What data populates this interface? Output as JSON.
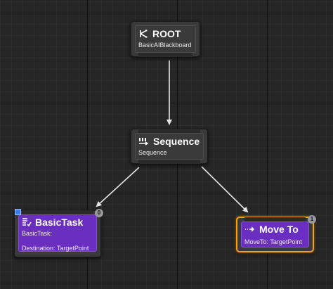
{
  "nodes": {
    "root": {
      "title": "ROOT",
      "subtitle": "BasicAIBlackboard",
      "icon": "root-branch-icon"
    },
    "sequence": {
      "title": "Sequence",
      "subtitle": "Sequence",
      "icon": "sequence-icon"
    },
    "basic_task": {
      "title": "BasicTask",
      "line1": "BasicTask:",
      "line2": "Destination: TargetPoint",
      "order": "0",
      "icon": "task-list-icon"
    },
    "move_to": {
      "title": "Move To",
      "subtitle": "MoveTo: TargetPoint",
      "order": "1",
      "icon": "move-arrow-icon"
    }
  },
  "colors": {
    "background": "#262626",
    "node_body": "#3a3a3a",
    "task_purple": "#6a2fc0",
    "selected_outline": "#f2a018",
    "wire": "#e6e6e6"
  }
}
